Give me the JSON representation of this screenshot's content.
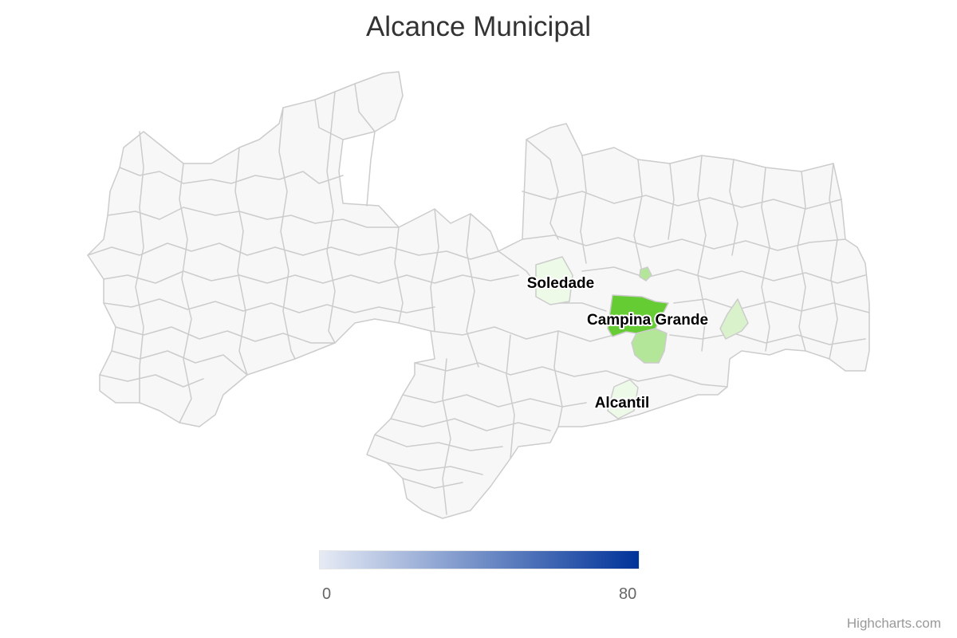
{
  "title": "Alcance Municipal",
  "colors": {
    "base_fill": "#f7f7f7",
    "border": "#cccccc",
    "scale_min": "#e6ebf5",
    "scale_max": "#003399",
    "campina_grande": "#66cc33",
    "dark_highlight": "#b3e699",
    "light_highlight": "#d9f2cc",
    "pale_highlight": "#eefae8"
  },
  "legend": {
    "min_label": "0",
    "max_label": "80"
  },
  "labels": {
    "soledade": "Soledade",
    "campina_grande": "Campina Grande",
    "alcantil": "Alcantil"
  },
  "credits": "Highcharts.com"
}
